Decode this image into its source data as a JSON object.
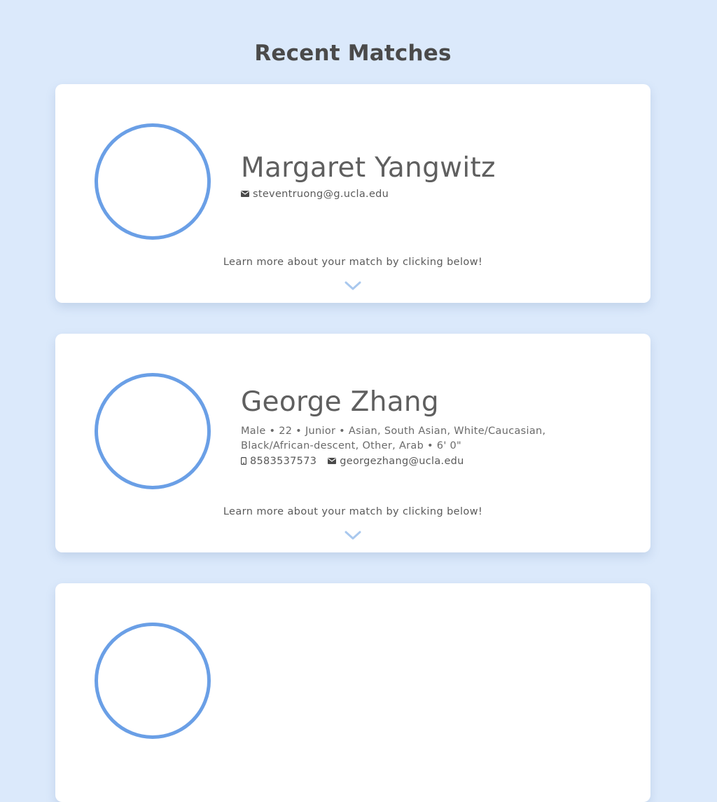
{
  "page": {
    "title": "Recent Matches"
  },
  "matches": [
    {
      "name": "Margaret Yangwitz",
      "details": "",
      "phone": "",
      "email": "steventruong@g.ucla.edu",
      "learn_more": "Learn more about your match by clicking below!"
    },
    {
      "name": "George Zhang",
      "details": "Male • 22 • Junior • Asian, South Asian, White/Caucasian, Black/African-descent, Other, Arab • 6' 0\"",
      "phone": "8583537573",
      "email": "georgezhang@ucla.edu",
      "learn_more": "Learn more about your match by clicking below!"
    }
  ],
  "colors": {
    "background": "#dbe9fb",
    "accent": "#6a9fe6",
    "chevron": "#a9c8ee"
  },
  "icons": {
    "email": "envelope-icon",
    "phone": "mobile-phone-icon",
    "expand": "chevron-down-icon"
  }
}
